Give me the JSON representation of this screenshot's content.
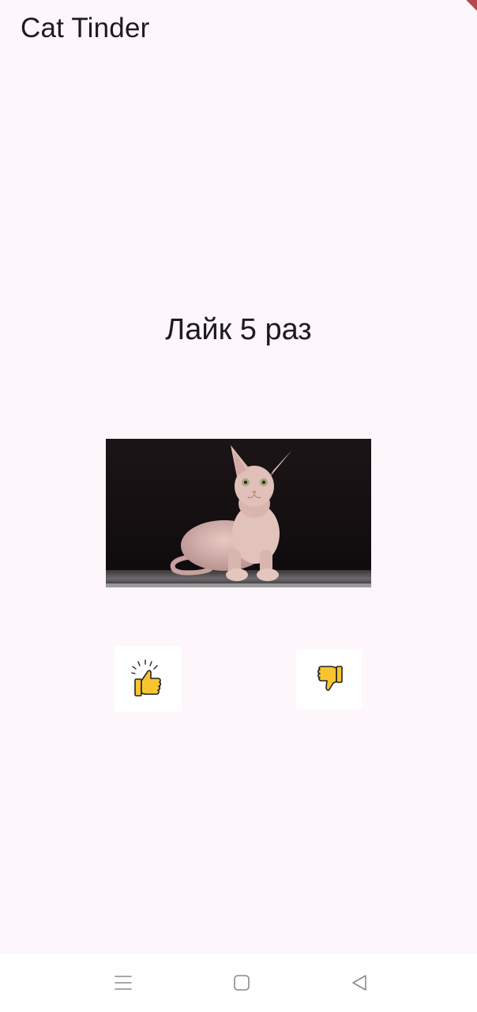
{
  "app": {
    "title": "Cat Tinder"
  },
  "counter": {
    "text": "Лайк 5 раз"
  },
  "photo": {
    "subject": "sphynx cat lying on a dark surface against a black background"
  },
  "buttons": {
    "like_icon": "thumbs-up-icon",
    "dislike_icon": "thumbs-down-icon",
    "icon_color": "#f7c530"
  },
  "system_nav": {
    "menu_icon": "menu-icon",
    "home_icon": "home-icon",
    "back_icon": "back-icon"
  },
  "colors": {
    "background": "#fdf6fb",
    "text": "#1e1b20",
    "debug_banner": "#b5474f"
  }
}
